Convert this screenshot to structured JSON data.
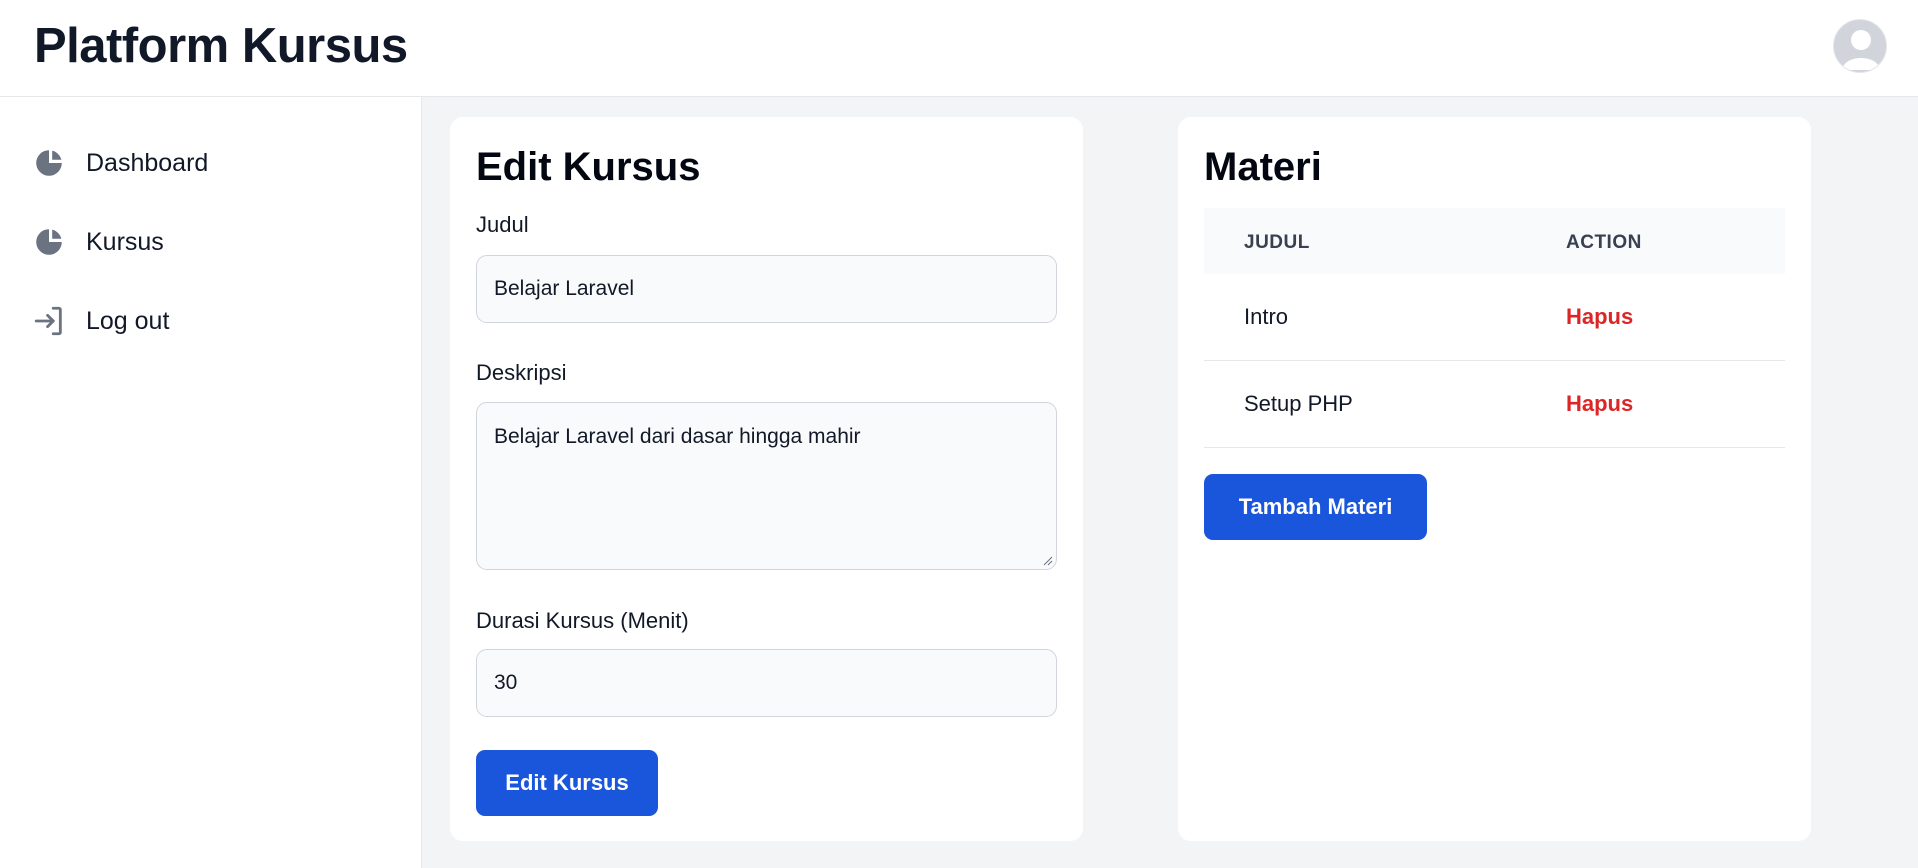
{
  "header": {
    "brand": "Platform Kursus"
  },
  "sidebar": {
    "items": [
      {
        "label": "Dashboard",
        "icon": "chart-pie-icon"
      },
      {
        "label": "Kursus",
        "icon": "chart-pie-icon"
      },
      {
        "label": "Log out",
        "icon": "logout-icon"
      }
    ]
  },
  "edit_form": {
    "title": "Edit Kursus",
    "judul_label": "Judul",
    "judul_value": "Belajar Laravel",
    "deskripsi_label": "Deskripsi",
    "deskripsi_value": "Belajar Laravel dari dasar hingga mahir",
    "durasi_label": "Durasi Kursus (Menit)",
    "durasi_value": "30",
    "submit_label": "Edit Kursus"
  },
  "materi": {
    "title": "Materi",
    "columns": [
      "JUDUL",
      "ACTION"
    ],
    "rows": [
      {
        "judul": "Intro",
        "action": "Hapus"
      },
      {
        "judul": "Setup PHP",
        "action": "Hapus"
      }
    ],
    "add_label": "Tambah Materi"
  },
  "colors": {
    "primary": "#1a56db",
    "danger": "#dc2626",
    "icon": "#6b7280"
  }
}
